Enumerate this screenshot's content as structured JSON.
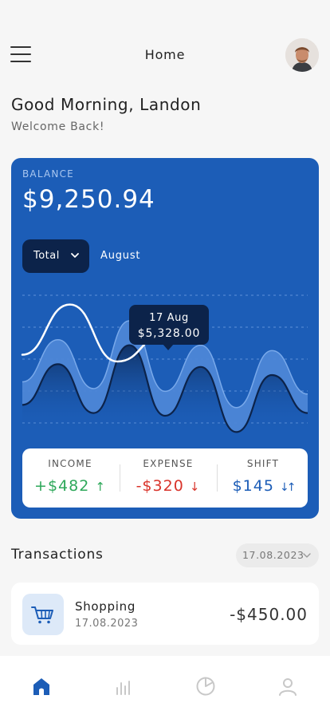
{
  "header": {
    "title": "Home",
    "menu_icon": "hamburger-menu-icon",
    "avatar": "user-avatar"
  },
  "greeting": {
    "title": "Good Morning, Landon",
    "subtitle": "Welcome Back!"
  },
  "balance_card": {
    "label": "BALANCE",
    "amount": "$9,250.94",
    "period_select": {
      "selected": "Total",
      "icon": "chevron-down-icon"
    },
    "month": "August",
    "tooltip": {
      "date": "17 Aug",
      "value": "$5,328.00"
    },
    "stats": [
      {
        "label": "INCOME",
        "value": "+$482",
        "arrow": "↑",
        "color": "#2ea85a",
        "icon": "arrow-up-icon"
      },
      {
        "label": "EXPENSE",
        "value": "-$320",
        "arrow": "↓",
        "color": "#d9342b",
        "icon": "arrow-down-icon"
      },
      {
        "label": "SHIFT",
        "value": "$145",
        "arrow": "↓↑",
        "color": "#1c5db7",
        "icon": "arrows-up-down-icon"
      }
    ]
  },
  "chart_data": {
    "type": "line",
    "series": [
      {
        "values": [
          0.18,
          0.48,
          0.12,
          0.62,
          0.1,
          0.46,
          -0.02,
          0.4,
          0.12
        ]
      },
      {
        "values": [
          0.35,
          0.66,
          0.3,
          0.8,
          0.28,
          0.62,
          0.16,
          0.58,
          0.26
        ]
      },
      {
        "values": [
          0.55,
          0.92,
          0.5,
          0.7
        ]
      }
    ],
    "highlight": {
      "series": 2,
      "index": 3
    },
    "grid": true,
    "colors": {
      "band": "#4d86d6",
      "dark": "#0c234a",
      "light": "#ffffff"
    }
  },
  "transactions": {
    "title": "Transactions",
    "date_filter": "17.08.2023",
    "items": [
      {
        "name": "Shopping",
        "date": "17.08.2023",
        "amount": "-$450.00",
        "icon": "shopping-cart-icon"
      }
    ]
  },
  "tabbar": {
    "tabs": [
      {
        "name": "home",
        "icon": "home-icon",
        "active": true
      },
      {
        "name": "stats",
        "icon": "bar-chart-icon",
        "active": false
      },
      {
        "name": "analytics",
        "icon": "pie-chart-icon",
        "active": false
      },
      {
        "name": "profile",
        "icon": "user-icon",
        "active": false
      }
    ]
  },
  "colors": {
    "primary": "#1c5db7",
    "dark_navy": "#0c234a",
    "income": "#2ea85a",
    "expense": "#d9342b"
  }
}
